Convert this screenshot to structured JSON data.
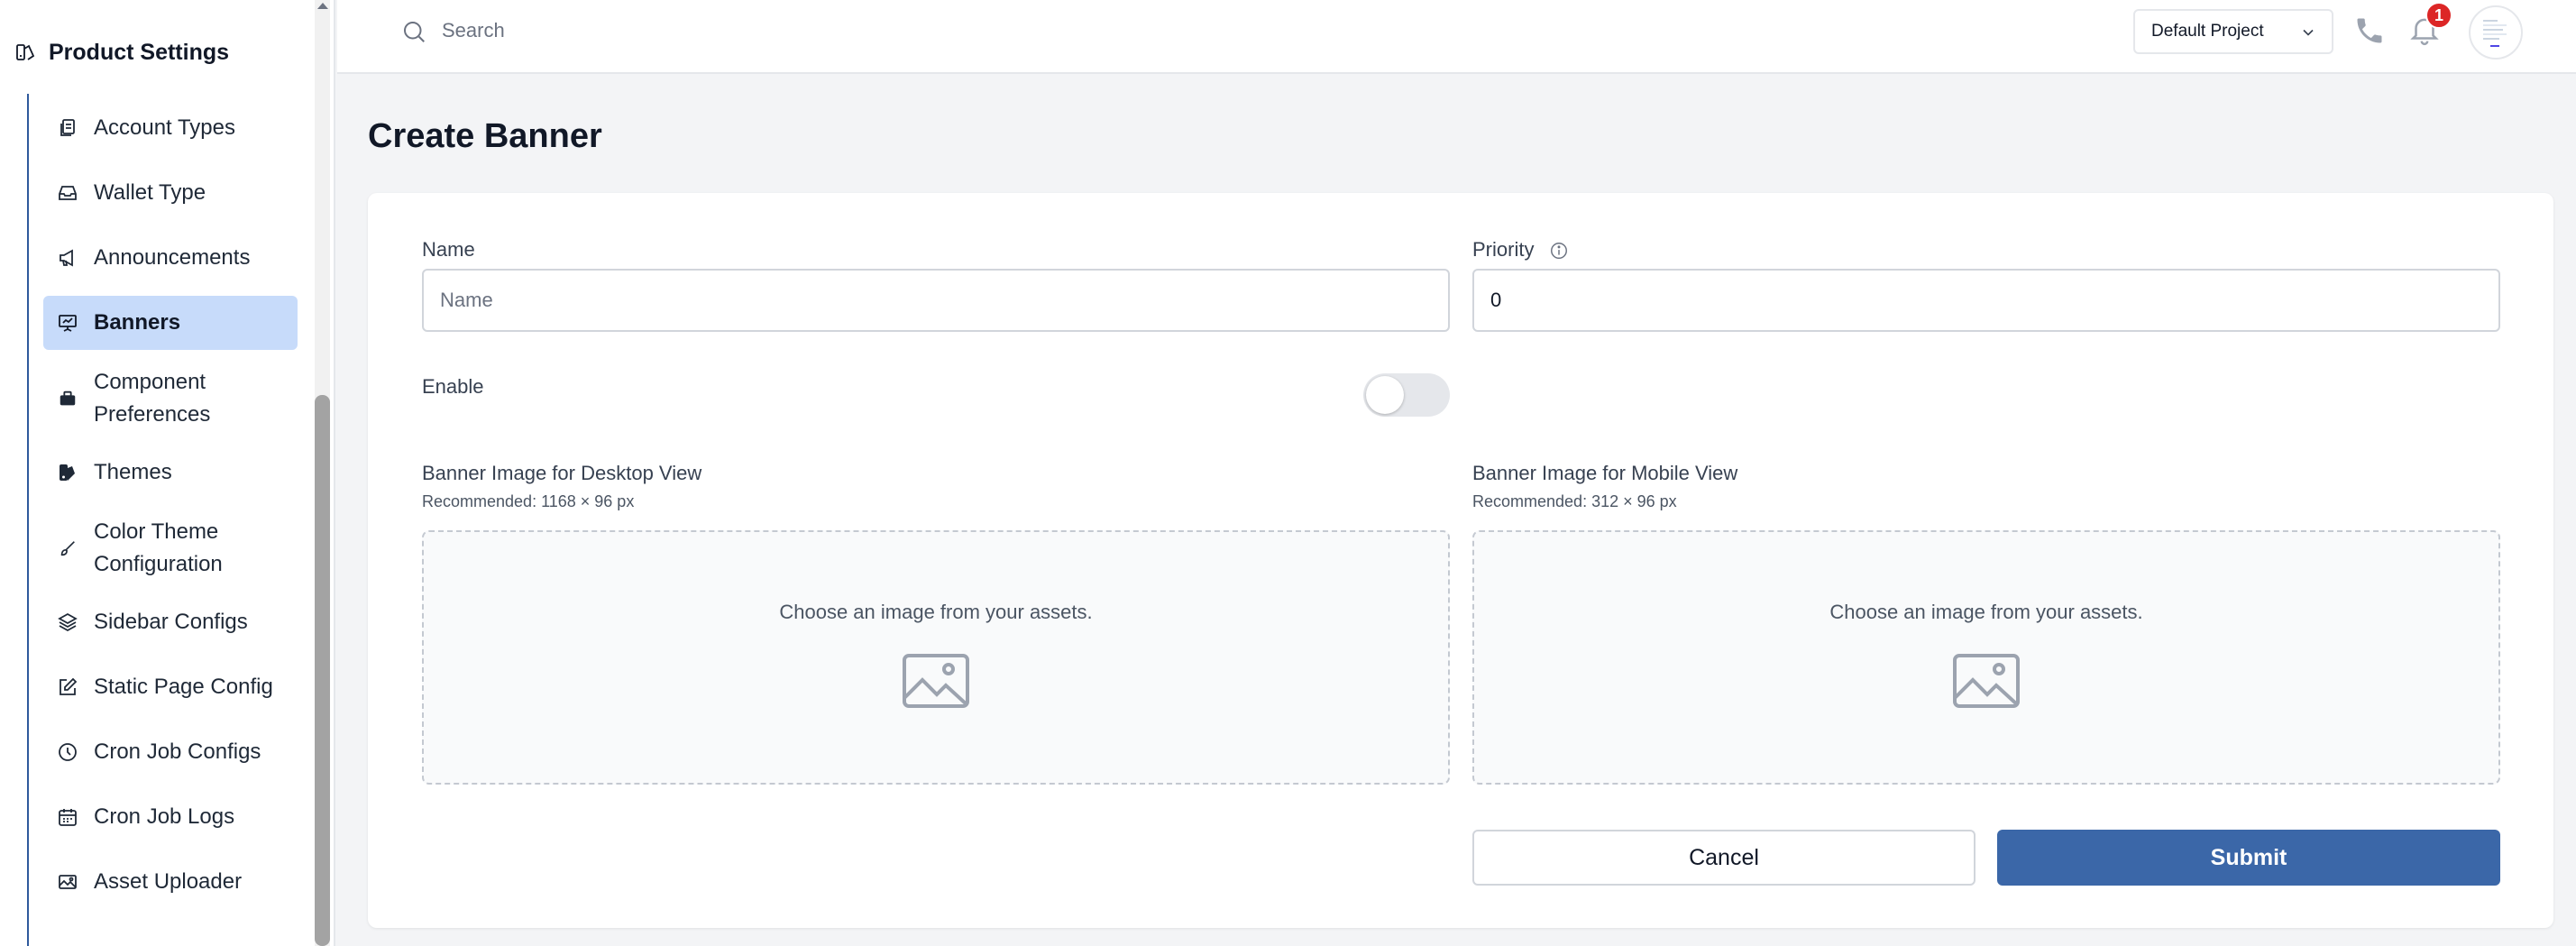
{
  "sidebar": {
    "header_title": "Product Settings",
    "items": [
      {
        "label": "Account Types",
        "icon": "document-stack-icon"
      },
      {
        "label": "Wallet Type",
        "icon": "tray-icon"
      },
      {
        "label": "Announcements",
        "icon": "megaphone-icon"
      },
      {
        "label": "Banners",
        "icon": "presentation-chart-icon",
        "active": true
      },
      {
        "label": "Component Preferences",
        "icon": "briefcase-icon"
      },
      {
        "label": "Themes",
        "icon": "swatch-icon"
      },
      {
        "label": "Color Theme Configuration",
        "icon": "paint-brush-icon"
      },
      {
        "label": "Sidebar Configs",
        "icon": "layers-icon"
      },
      {
        "label": "Static Page Config",
        "icon": "pencil-square-icon"
      },
      {
        "label": "Cron Job Configs",
        "icon": "clock-icon"
      },
      {
        "label": "Cron Job Logs",
        "icon": "calendar-icon"
      },
      {
        "label": "Asset Uploader",
        "icon": "image-icon"
      }
    ]
  },
  "topbar": {
    "search_placeholder": "Search",
    "project_selected": "Default Project",
    "notification_count": "1"
  },
  "page": {
    "title": "Create Banner"
  },
  "form": {
    "name_label": "Name",
    "name_placeholder": "Name",
    "priority_label": "Priority",
    "priority_value": "0",
    "enable_label": "Enable",
    "enable_on": false,
    "desktop_label": "Banner Image for Desktop View",
    "desktop_hint": "Recommended: 1168 × 96 px",
    "mobile_label": "Banner Image for Mobile View",
    "mobile_hint": "Recommended: 312 × 96 px",
    "dropzone_text": "Choose an image from your assets.",
    "cancel_label": "Cancel",
    "submit_label": "Submit"
  },
  "colors": {
    "accent": "#3b67a8",
    "active_nav_bg": "#c7dbfa",
    "badge": "#dc2626",
    "page_bg": "#f3f4f6"
  }
}
